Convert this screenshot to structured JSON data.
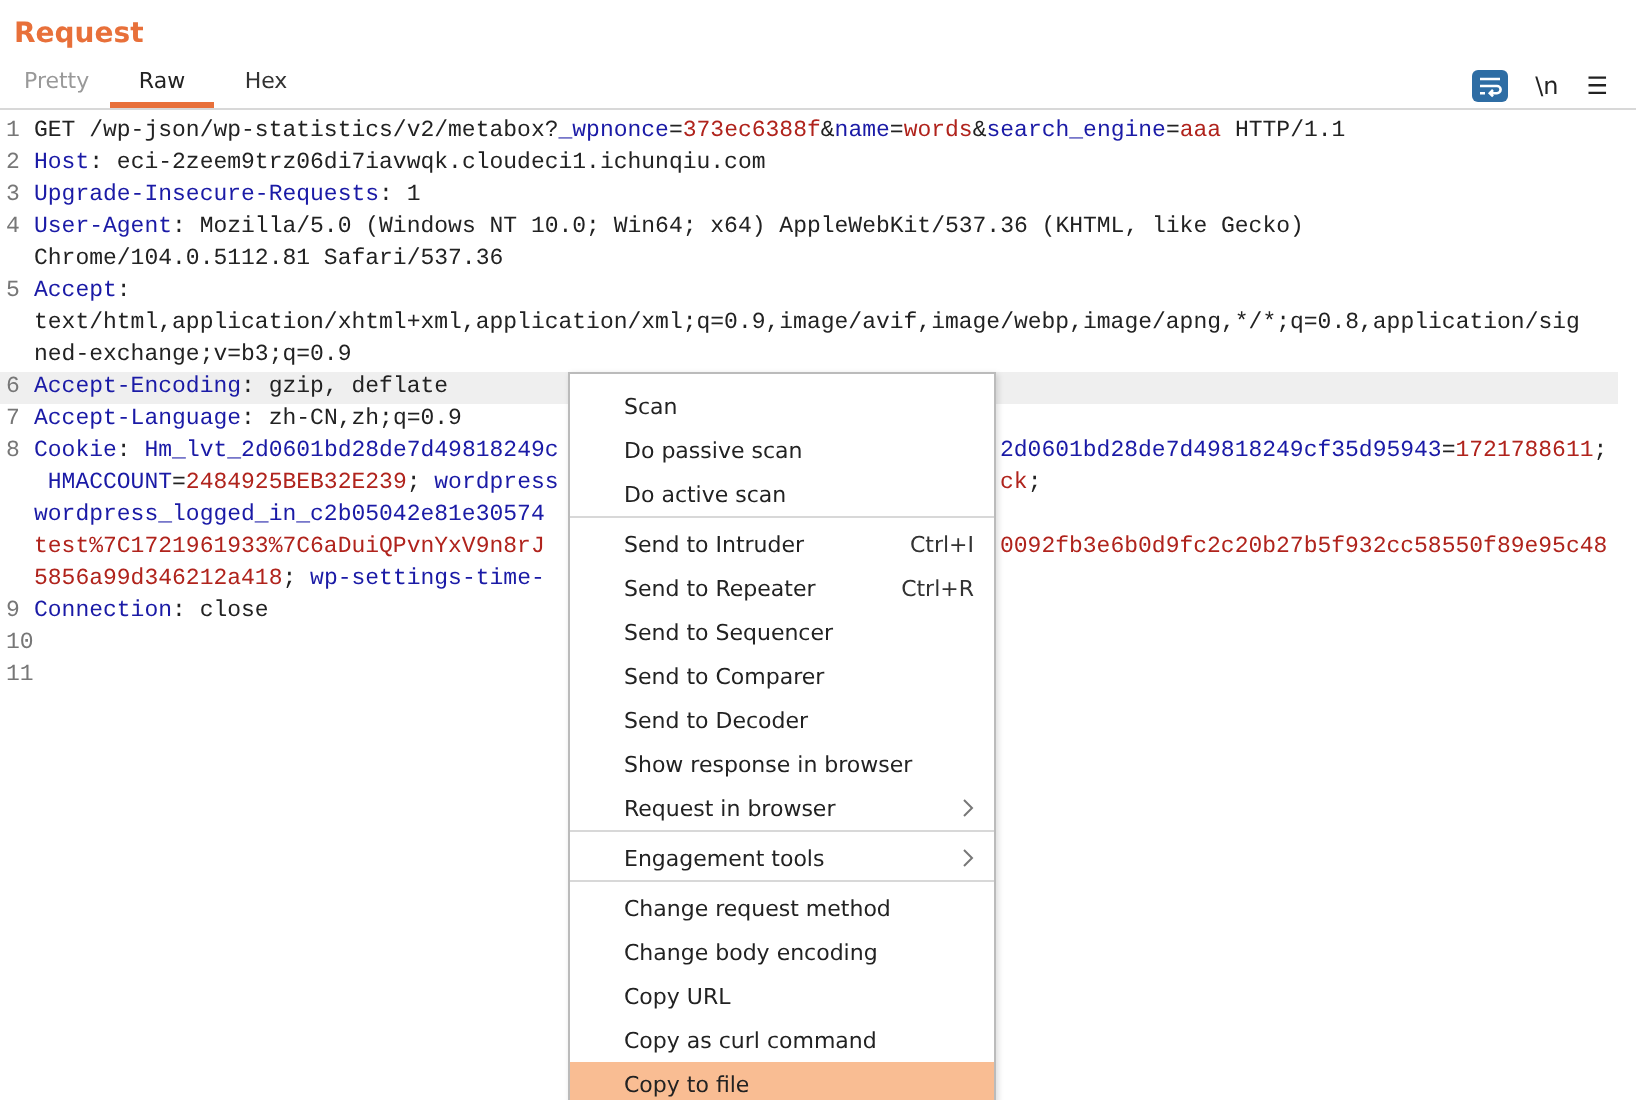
{
  "panel": {
    "title": "Request"
  },
  "tabs": [
    {
      "label": "Pretty",
      "selected": false
    },
    {
      "label": "Raw",
      "selected": true
    },
    {
      "label": "Hex",
      "selected": false
    }
  ],
  "toolbar": {
    "wrap_on": true,
    "newline_label": "\\n",
    "menu_glyph": "☰"
  },
  "lines": [
    {
      "number": "1",
      "highlighted": false,
      "rows": [
        {
          "left": [
            {
              "kind": "plain",
              "text": "GET /wp-json/wp-statistics/v2/metabox?"
            },
            {
              "kind": "name",
              "text": "_wpnonce"
            },
            {
              "kind": "plain",
              "text": "="
            },
            {
              "kind": "value",
              "text": "373ec6388f"
            },
            {
              "kind": "plain",
              "text": "&"
            },
            {
              "kind": "name",
              "text": "name"
            },
            {
              "kind": "plain",
              "text": "="
            },
            {
              "kind": "value",
              "text": "words"
            },
            {
              "kind": "plain",
              "text": "&"
            },
            {
              "kind": "name",
              "text": "search_engine"
            },
            {
              "kind": "plain",
              "text": "="
            },
            {
              "kind": "value",
              "text": "aaa"
            },
            {
              "kind": "plain",
              "text": " HTTP/1.1"
            }
          ]
        }
      ]
    },
    {
      "number": "2",
      "highlighted": false,
      "rows": [
        {
          "left": [
            {
              "kind": "name",
              "text": "Host"
            },
            {
              "kind": "plain",
              "text": ": eci-2zeem9trz06di7iavwqk.cloudeci1.ichunqiu.com"
            }
          ]
        }
      ]
    },
    {
      "number": "3",
      "highlighted": false,
      "rows": [
        {
          "left": [
            {
              "kind": "name",
              "text": "Upgrade-Insecure-Requests"
            },
            {
              "kind": "plain",
              "text": ": 1"
            }
          ]
        }
      ]
    },
    {
      "number": "4",
      "highlighted": false,
      "rows": [
        {
          "left": [
            {
              "kind": "name",
              "text": "User-Agent"
            },
            {
              "kind": "plain",
              "text": ": Mozilla/5.0 (Windows NT 10.0; Win64; x64) AppleWebKit/537.36 (KHTML, like Gecko)"
            }
          ]
        },
        {
          "left": [
            {
              "kind": "plain",
              "text": "Chrome/104.0.5112.81 Safari/537.36"
            }
          ]
        }
      ]
    },
    {
      "number": "5",
      "highlighted": false,
      "rows": [
        {
          "left": [
            {
              "kind": "name",
              "text": "Accept"
            },
            {
              "kind": "plain",
              "text": ":"
            }
          ]
        },
        {
          "left": [
            {
              "kind": "plain",
              "text": "text/html,application/xhtml+xml,application/xml;q=0.9,image/avif,image/webp,image/apng,*/*;q=0.8,application/sig"
            }
          ]
        },
        {
          "left": [
            {
              "kind": "plain",
              "text": "ned-exchange;v=b3;q=0.9"
            }
          ]
        }
      ]
    },
    {
      "number": "6",
      "highlighted": true,
      "rows": [
        {
          "left": [
            {
              "kind": "name",
              "text": "Accept-Encoding"
            },
            {
              "kind": "plain",
              "text": ": gzip, deflate"
            }
          ]
        }
      ]
    },
    {
      "number": "7",
      "highlighted": false,
      "rows": [
        {
          "left": [
            {
              "kind": "name",
              "text": "Accept-Language"
            },
            {
              "kind": "plain",
              "text": ": zh-CN,zh;q=0.9"
            }
          ]
        }
      ]
    },
    {
      "number": "8",
      "highlighted": false,
      "rows": [
        {
          "left": [
            {
              "kind": "name",
              "text": "Cookie"
            },
            {
              "kind": "plain",
              "text": ": "
            },
            {
              "kind": "name",
              "text": "Hm_lvt_2d0601bd28de7d49818249c"
            }
          ],
          "right": [
            {
              "kind": "name",
              "text": "2d0601bd28de7d49818249cf35d95943"
            },
            {
              "kind": "plain",
              "text": "="
            },
            {
              "kind": "value",
              "text": "1721788611"
            },
            {
              "kind": "plain",
              "text": ";"
            }
          ]
        },
        {
          "left": [
            {
              "kind": "name",
              "text": " HMACCOUNT"
            },
            {
              "kind": "plain",
              "text": "="
            },
            {
              "kind": "value",
              "text": "2484925BEB32E239"
            },
            {
              "kind": "plain",
              "text": "; "
            },
            {
              "kind": "name",
              "text": "wordpress"
            }
          ],
          "right": [
            {
              "kind": "value",
              "text": "ck"
            },
            {
              "kind": "plain",
              "text": ";"
            }
          ]
        },
        {
          "left": [
            {
              "kind": "name",
              "text": "wordpress_logged_in_c2b05042e81e30574"
            }
          ]
        },
        {
          "left": [
            {
              "kind": "value",
              "text": "test%7C1721961933%7C6aDuiQPvnYxV9n8rJ"
            }
          ],
          "right": [
            {
              "kind": "value",
              "text": "0092fb3e6b0d9fc2c20b27b5f932cc58550f89e95c48"
            }
          ]
        },
        {
          "left": [
            {
              "kind": "value",
              "text": "5856a99d346212a418"
            },
            {
              "kind": "plain",
              "text": "; "
            },
            {
              "kind": "name",
              "text": "wp-settings-time-"
            }
          ]
        }
      ]
    },
    {
      "number": "9",
      "highlighted": false,
      "rows": [
        {
          "left": [
            {
              "kind": "name",
              "text": "Connection"
            },
            {
              "kind": "plain",
              "text": ": close"
            }
          ]
        }
      ]
    },
    {
      "number": "10",
      "highlighted": false,
      "rows": [
        {
          "left": []
        }
      ]
    },
    {
      "number": "11",
      "highlighted": false,
      "rows": [
        {
          "left": []
        }
      ]
    }
  ],
  "context_menu": {
    "groups": [
      [
        {
          "label": "Scan",
          "selected": false
        },
        {
          "label": "Do passive scan",
          "selected": false
        },
        {
          "label": "Do active scan",
          "selected": false
        }
      ],
      [
        {
          "label": "Send to Intruder",
          "shortcut": "Ctrl+I",
          "selected": false
        },
        {
          "label": "Send to Repeater",
          "shortcut": "Ctrl+R",
          "selected": false
        },
        {
          "label": "Send to Sequencer",
          "selected": false
        },
        {
          "label": "Send to Comparer",
          "selected": false
        },
        {
          "label": "Send to Decoder",
          "selected": false
        },
        {
          "label": "Show response in browser",
          "selected": false
        },
        {
          "label": "Request in browser",
          "submenu": true,
          "selected": false
        }
      ],
      [
        {
          "label": "Engagement tools",
          "submenu": true,
          "selected": false
        }
      ],
      [
        {
          "label": "Change request method",
          "selected": false
        },
        {
          "label": "Change body encoding",
          "selected": false
        },
        {
          "label": "Copy URL",
          "selected": false
        },
        {
          "label": "Copy as curl command",
          "selected": false
        },
        {
          "label": "Copy to file",
          "selected": true
        }
      ]
    ]
  }
}
